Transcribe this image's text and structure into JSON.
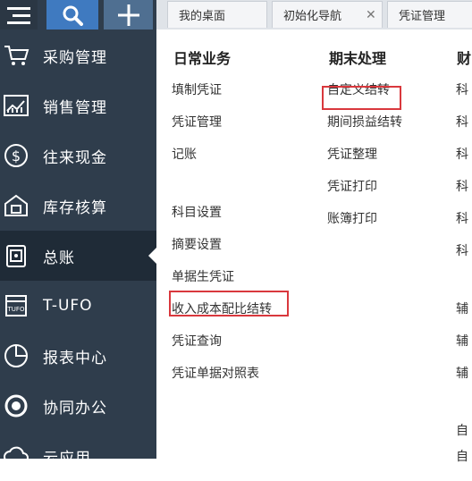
{
  "sidebar": {
    "items": [
      {
        "label": "采购管理",
        "icon": "cart-icon"
      },
      {
        "label": "销售管理",
        "icon": "bar-chart-icon"
      },
      {
        "label": "往来现金",
        "icon": "dollar-coin-icon"
      },
      {
        "label": "库存核算",
        "icon": "warehouse-icon"
      },
      {
        "label": "总账",
        "icon": "ledger-book-icon",
        "active": true
      },
      {
        "label": "T-UFO",
        "icon": "tufo-icon"
      },
      {
        "label": "报表中心",
        "icon": "pie-chart-icon"
      },
      {
        "label": "协同办公",
        "icon": "collaboration-icon"
      },
      {
        "label": "云应用",
        "icon": "cloud-icon"
      }
    ]
  },
  "tabs": [
    {
      "label": "我的桌面"
    },
    {
      "label": "初始化导航"
    },
    {
      "label": "凭证管理"
    }
  ],
  "menu": {
    "col1": {
      "title": "日常业务",
      "items": [
        "填制凭证",
        "凭证管理",
        "记账",
        "科目设置",
        "摘要设置",
        "单据生凭证",
        "收入成本配比结转",
        "凭证查询",
        "凭证单据对照表"
      ]
    },
    "col2": {
      "title": "期末处理",
      "items": [
        "自定义结转",
        "期间损益结转",
        "凭证整理",
        "凭证打印",
        "账簿打印"
      ]
    },
    "col3": {
      "title": "财",
      "items": [
        "科",
        "科",
        "科",
        "科",
        "科",
        "科",
        "辅",
        "辅",
        "辅",
        "自",
        "自"
      ]
    }
  },
  "colors": {
    "sidebar_bg": "#2f3d4c",
    "active_bg": "#1f2b37",
    "highlight": "#d9383d",
    "search_btn": "#3f7ac0"
  }
}
